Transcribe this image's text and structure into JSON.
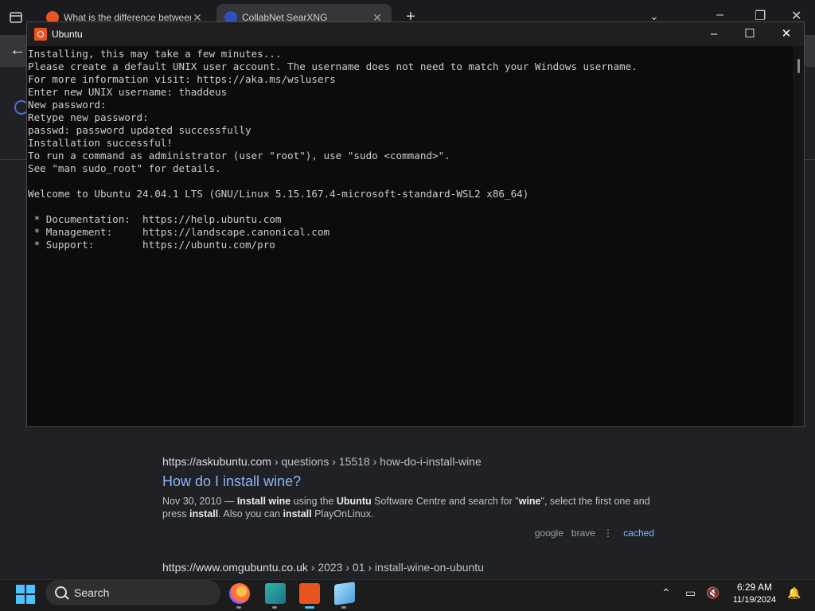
{
  "browser": {
    "tabs": [
      {
        "title": "What is the difference between",
        "close": "✕"
      },
      {
        "title": "CollabNet SearXNG",
        "close": "✕"
      }
    ],
    "new_tab": "+",
    "back": "←",
    "result": {
      "url_host": "https://askubuntu.com",
      "url_path": "› questions › 15518 › how-do-i-install-wine",
      "title": "How do I install wine?",
      "snippet_parts": [
        "Nov 30, 2010 — ",
        "Install wine",
        " using the ",
        "Ubuntu",
        " Software Centre and search for \"",
        "wine",
        "\", select the first one and press ",
        "install",
        ". Also you can ",
        "install",
        " PlayOnLinux."
      ],
      "engines": [
        "google",
        "brave"
      ],
      "cached": "cached"
    },
    "next_result": {
      "url_host": "https://www.omgubuntu.co.uk",
      "url_path": "› 2023 › 01 › install-wine-on-ubuntu"
    }
  },
  "terminal": {
    "title": "Ubuntu",
    "lines": [
      "Installing, this may take a few minutes...",
      "Please create a default UNIX user account. The username does not need to match your Windows username.",
      "For more information visit: https://aka.ms/wslusers",
      "Enter new UNIX username: thaddeus",
      "New password:",
      "Retype new password:",
      "passwd: password updated successfully",
      "Installation successful!",
      "To run a command as administrator (user \"root\"), use \"sudo <command>\".",
      "See \"man sudo_root\" for details.",
      "",
      "Welcome to Ubuntu 24.04.1 LTS (GNU/Linux 5.15.167.4-microsoft-standard-WSL2 x86_64)",
      "",
      " * Documentation:  https://help.ubuntu.com",
      " * Management:     https://landscape.canonical.com",
      " * Support:        https://ubuntu.com/pro"
    ]
  },
  "taskbar": {
    "search_label": "Search",
    "time": "6:29 AM",
    "date": "11/19/2024"
  },
  "colors": {
    "accent": "#4cc2ff",
    "link": "#8ab4f8",
    "ubuntu_orange": "#e95420"
  }
}
